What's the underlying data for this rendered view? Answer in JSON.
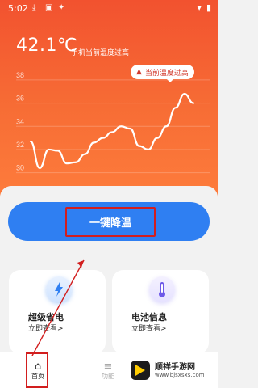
{
  "status_bar": {
    "time": "5:02"
  },
  "hero": {
    "temperature": "42.1℃",
    "temperature_label": "手机当前温度过高",
    "alert_text": "当前温度过高",
    "colors": {
      "bg_top": "#f2522f",
      "bg_bottom": "#ff7f3d"
    }
  },
  "chart_data": {
    "type": "line",
    "y_ticks": [
      38,
      36,
      34,
      32,
      30
    ],
    "x": [
      0,
      1,
      2,
      3,
      4,
      5,
      6,
      7,
      8,
      9,
      10,
      11,
      12,
      13,
      14,
      15,
      16,
      17,
      18
    ],
    "values": [
      32.7,
      30.4,
      32.0,
      31.9,
      30.8,
      30.9,
      31.6,
      32.6,
      33.0,
      33.5,
      34.0,
      33.8,
      32.3,
      32.0,
      33.0,
      34.0,
      35.6,
      36.8,
      36.0
    ],
    "ylim": [
      29.0,
      38.2
    ],
    "grid": true,
    "line_color": "#ffffff"
  },
  "actions": {
    "cool_down_label": "一键降温"
  },
  "cards": [
    {
      "title": "超级省电",
      "subtitle": "立即查看>",
      "icon": "lightning-icon"
    },
    {
      "title": "电池信息",
      "subtitle": "立即查看>",
      "icon": "thermometer-icon"
    }
  ],
  "nav": {
    "home_label": "首页",
    "features_label": "功能"
  },
  "watermark": {
    "title": "顺祥手游网",
    "domain": "www.bjsxsxs.com"
  }
}
